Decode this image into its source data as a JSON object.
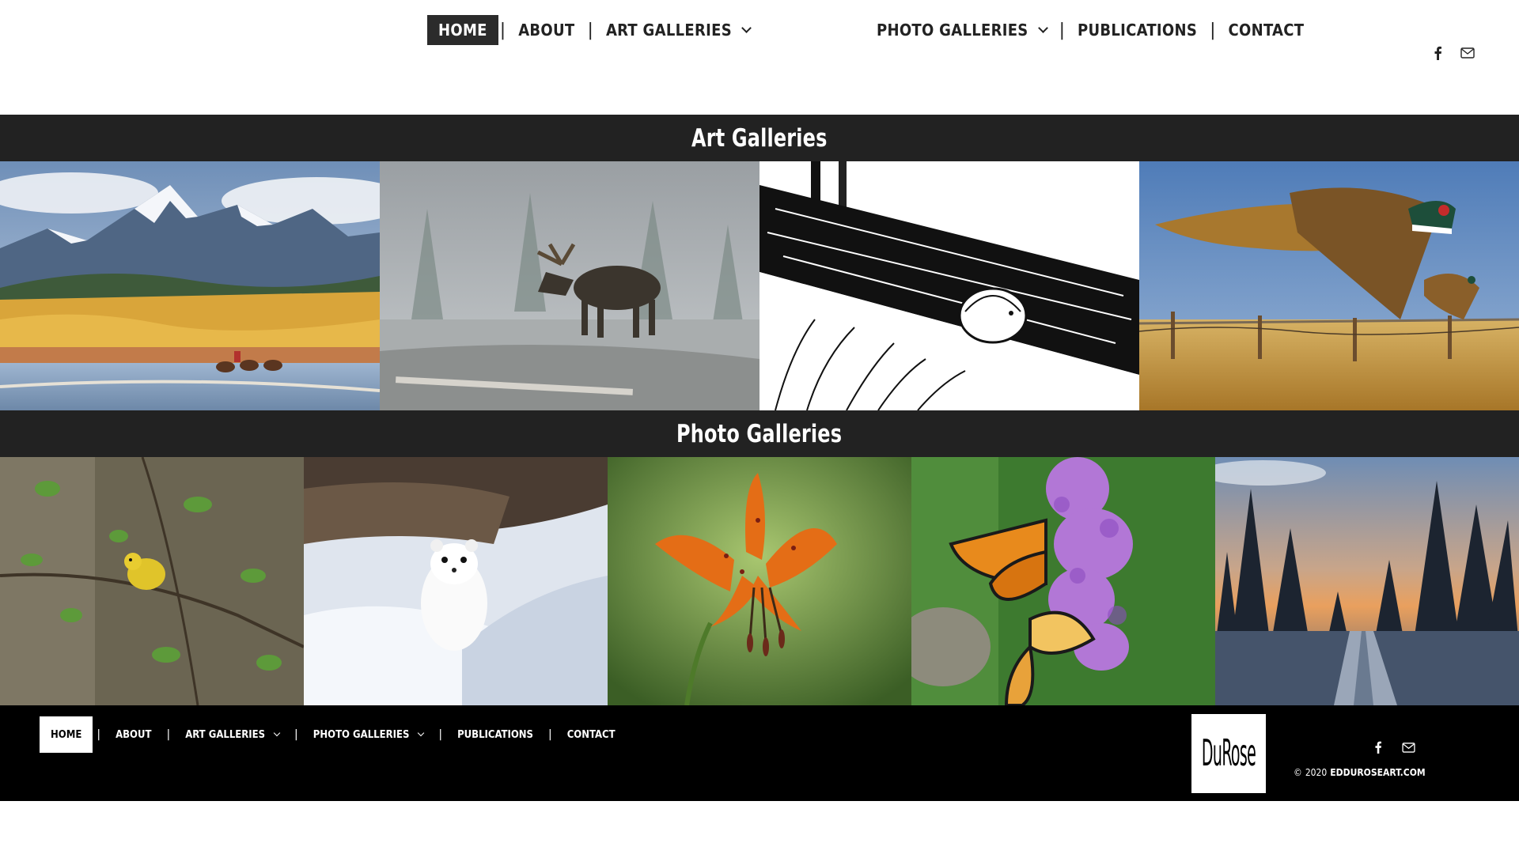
{
  "nav": {
    "items": [
      {
        "label": "Home",
        "active": true,
        "dropdown": false
      },
      {
        "label": "About",
        "active": false,
        "dropdown": false
      },
      {
        "label": "Art Galleries",
        "active": false,
        "dropdown": true
      },
      {
        "label": "Photo Galleries",
        "active": false,
        "dropdown": true
      },
      {
        "label": "Publications",
        "active": false,
        "dropdown": false
      },
      {
        "label": "Contact",
        "active": false,
        "dropdown": false
      }
    ],
    "separator": "|"
  },
  "social": {
    "icons": [
      "facebook-icon",
      "email-icon"
    ]
  },
  "sections": {
    "art_title": "Art Galleries",
    "photo_title": "Photo Galleries"
  },
  "art_gallery": {
    "tiles": [
      "mountain-pack-horses-painting",
      "moose-in-fog-painting",
      "ruffed-grouse-ink-drawing",
      "pheasants-in-flight-painting"
    ]
  },
  "photo_gallery": {
    "tiles": [
      "yellow-warbler-photo",
      "ermine-in-snow-photo",
      "orange-lily-photo",
      "monarch-butterflies-photo",
      "winter-road-sunrise-photo"
    ]
  },
  "footer": {
    "logo_text": "DuRose",
    "copyright_symbol": "©",
    "year": "2020",
    "site": "edduroseart.com"
  },
  "colors": {
    "bar": "#222222",
    "footer": "#000000",
    "nav_active": "#2b2b2b"
  }
}
